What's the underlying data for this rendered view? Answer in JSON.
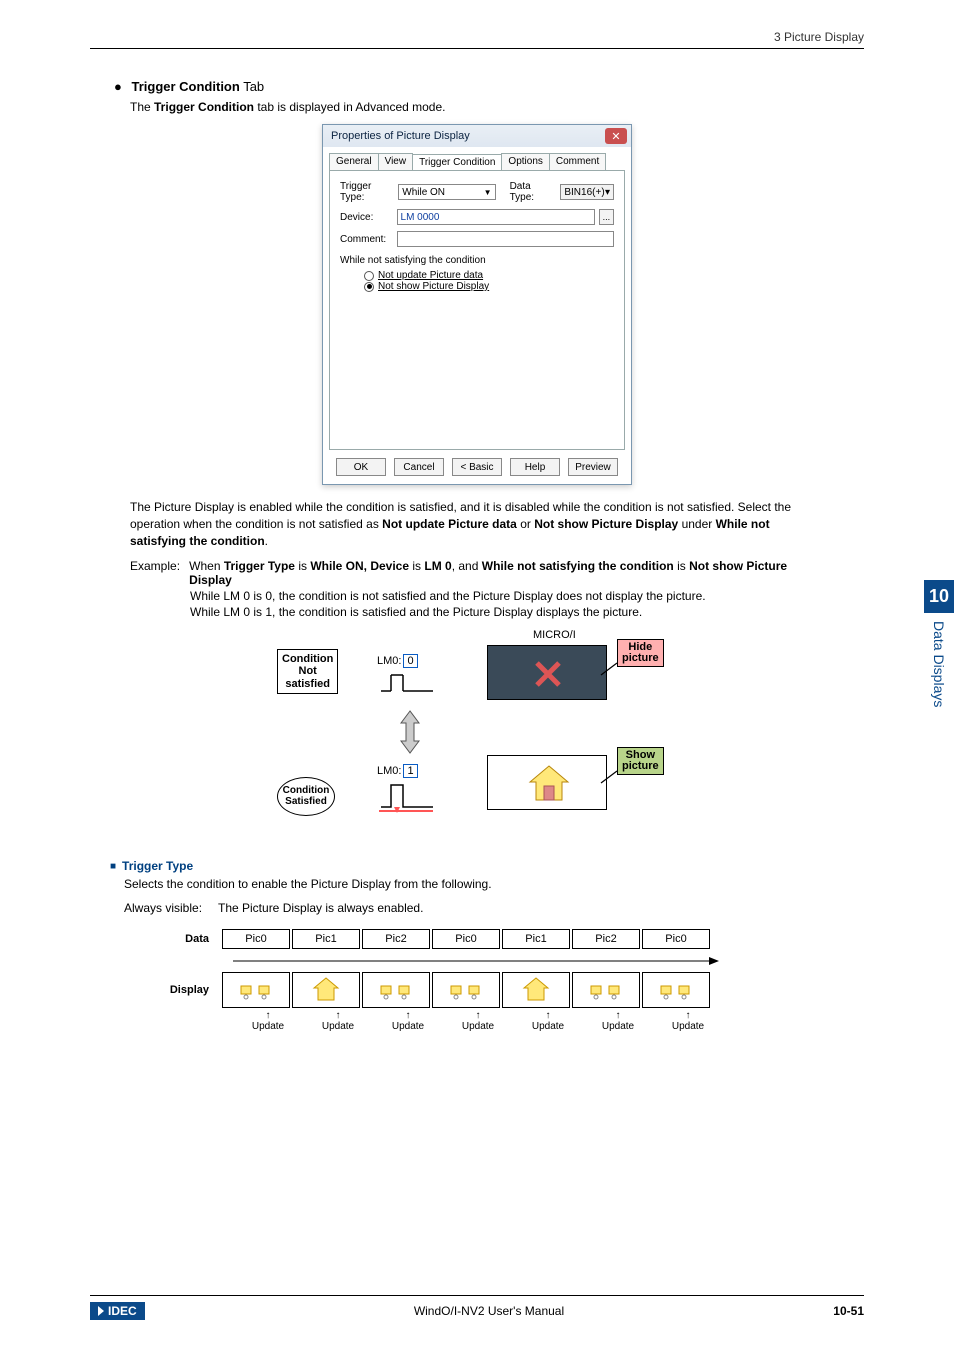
{
  "header_right": "3 Picture Display",
  "section": {
    "title_prefix": "Trigger Condition",
    "title_suffix": " Tab",
    "intro_pre": "The ",
    "intro_bold": "Trigger Condition",
    "intro_post": " tab is displayed in Advanced mode."
  },
  "dialog": {
    "title": "Properties of Picture Display",
    "tabs": [
      "General",
      "View",
      "Trigger Condition",
      "Options",
      "Comment"
    ],
    "active_tab": "Trigger Condition",
    "trigger_type_label": "Trigger Type:",
    "trigger_type_value": "While ON",
    "data_type_label": "Data Type:",
    "data_type_value": "BIN16(+)",
    "device_label": "Device:",
    "device_value": "LM 0000",
    "comment_label": "Comment:",
    "comment_value": "",
    "fieldset": "While not satisfying the condition",
    "radio1": "Not update Picture data",
    "radio2": "Not show Picture Display",
    "buttons": [
      "OK",
      "Cancel",
      "< Basic",
      "Help",
      "Preview"
    ]
  },
  "body": {
    "p1_a": "The Picture Display is enabled while the condition is satisfied, and it is disabled while the condition is not satisfied. Select the operation when the condition is not satisfied as ",
    "p1_b1": "Not update Picture data",
    "p1_or": " or ",
    "p1_b2": "Not show Picture Display",
    "p1_under_pre": " under ",
    "p1_under": "While not satisfying the condition",
    "p1_dot": "."
  },
  "example": {
    "label": "Example:",
    "line1_a": "When ",
    "line1_b1": "Trigger Type",
    "line1_is1": " is ",
    "line1_b2": "While ON, Device",
    "line1_is2": " is ",
    "line1_b3": "LM 0",
    "line1_and": ", and ",
    "line1_b4": "While not satisfying the condition",
    "line1_is3": " is ",
    "line1_b5": "Not show Picture Display",
    "line2": "While LM 0 is 0, the condition is not satisfied and the Picture Display does not display the picture.",
    "line3": "While LM 0 is 1, the condition is satisfied and the Picture Display displays the picture."
  },
  "diagram": {
    "micro_i": "MICRO/I",
    "cond_not": "Condition\nNot\nsatisfied",
    "cond_sat": "Condition\nSatisfied",
    "lm0_0": "LM0:",
    "lm0_0v": "0",
    "lm0_1": "LM0:",
    "lm0_1v": "1",
    "hide": "Hide\npicture",
    "show": "Show\npicture"
  },
  "sub": {
    "heading": "Trigger Type",
    "body": "Selects the condition to enable the Picture Display from the following.",
    "always_label": "Always visible:",
    "always_text": "The Picture Display is always enabled."
  },
  "timeline": {
    "data_label": "Data",
    "display_label": "Display",
    "data_cells": [
      "Pic0",
      "Pic1",
      "Pic2",
      "Pic0",
      "Pic1",
      "Pic2",
      "Pic0"
    ],
    "update": "Update"
  },
  "side": {
    "num": "10",
    "text": "Data Displays"
  },
  "footer": {
    "center": "WindO/I-NV2 User's Manual",
    "right": "10-51",
    "logo": "IDEC"
  }
}
